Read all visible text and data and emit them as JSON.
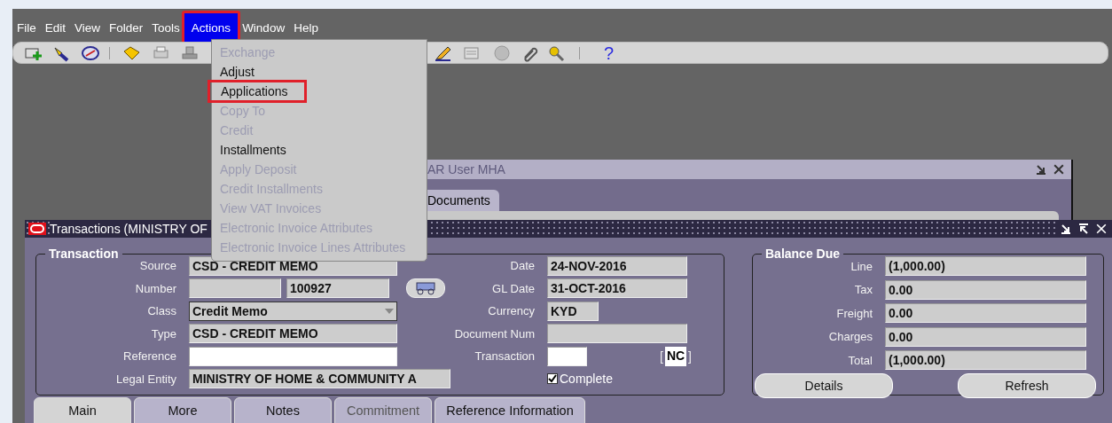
{
  "menubar": [
    {
      "label": "File",
      "selected": false,
      "outlined": false
    },
    {
      "label": "Edit",
      "selected": false,
      "outlined": false
    },
    {
      "label": "View",
      "selected": false,
      "outlined": false
    },
    {
      "label": "Folder",
      "selected": false,
      "outlined": false
    },
    {
      "label": "Tools",
      "selected": false,
      "outlined": false
    },
    {
      "label": "Actions",
      "selected": true,
      "outlined": true
    },
    {
      "label": "Window",
      "selected": false,
      "outlined": false
    },
    {
      "label": "Help",
      "selected": false,
      "outlined": false
    }
  ],
  "toolbar": {
    "help": "?"
  },
  "actions_menu": [
    {
      "label": "Exchange",
      "disabled": true,
      "outlined": false
    },
    {
      "label": "Adjust",
      "disabled": false,
      "outlined": false
    },
    {
      "label": "Applications",
      "disabled": false,
      "outlined": true
    },
    {
      "label": "Copy To",
      "disabled": true,
      "outlined": false
    },
    {
      "label": "Credit",
      "disabled": true,
      "outlined": false
    },
    {
      "label": "Installments",
      "disabled": false,
      "outlined": false
    },
    {
      "label": "Apply Deposit",
      "disabled": true,
      "outlined": false
    },
    {
      "label": "Credit Installments",
      "disabled": true,
      "outlined": false
    },
    {
      "label": "View VAT Invoices",
      "disabled": true,
      "outlined": false
    },
    {
      "label": "Electronic Invoice Attributes",
      "disabled": true,
      "outlined": false
    },
    {
      "label": "Electronic Invoice Lines Attributes",
      "disabled": true,
      "outlined": false
    }
  ],
  "background_window": {
    "title": "AR User MHA",
    "tabs": [
      {
        "label": "Documents"
      }
    ]
  },
  "transactions_window": {
    "title": "Transactions (MINISTRY OF",
    "transaction": {
      "title": "Transaction",
      "left": [
        {
          "label": "Source",
          "kind": "text",
          "value": "CSD - CREDIT MEMO"
        },
        {
          "label": "Number",
          "kind": "number",
          "value": "100927"
        },
        {
          "label": "Class",
          "kind": "dropdown",
          "value": "Credit Memo"
        },
        {
          "label": "Type",
          "kind": "text",
          "value": "CSD - CREDIT MEMO"
        },
        {
          "label": "Reference",
          "kind": "input"
        },
        {
          "label": "Legal Entity",
          "kind": "wide",
          "value": "MINISTRY OF HOME & COMMUNITY A"
        }
      ],
      "right": [
        {
          "label": "Date",
          "kind": "text",
          "value": "24-NOV-2016"
        },
        {
          "label": "GL Date",
          "kind": "text",
          "value": "31-OCT-2016"
        },
        {
          "label": "Currency",
          "kind": "short",
          "value": "KYD"
        },
        {
          "label": "Document Num",
          "kind": "text"
        },
        {
          "label": "Transaction",
          "kind": "input",
          "bracket_open": "[",
          "code": "NC",
          "bracket_close": "]"
        }
      ],
      "complete": {
        "label": "Complete",
        "checked": true
      }
    },
    "balance_due": {
      "title": "Balance Due",
      "rows": [
        {
          "label": "Line",
          "value": "(1,000.00)"
        },
        {
          "label": "Tax",
          "value": "0.00"
        },
        {
          "label": "Freight",
          "value": "0.00"
        },
        {
          "label": "Charges",
          "value": "0.00"
        },
        {
          "label": "Total",
          "value": "(1,000.00)"
        }
      ],
      "buttons": [
        "Details",
        "Refresh"
      ]
    },
    "tabs": [
      {
        "label": "Main",
        "selected": true,
        "disabled": false
      },
      {
        "label": "More",
        "selected": false,
        "disabled": false
      },
      {
        "label": "Notes",
        "selected": false,
        "disabled": false
      },
      {
        "label": "Commitment",
        "selected": false,
        "disabled": true
      },
      {
        "label": "Reference Information",
        "selected": false,
        "disabled": false
      }
    ]
  }
}
